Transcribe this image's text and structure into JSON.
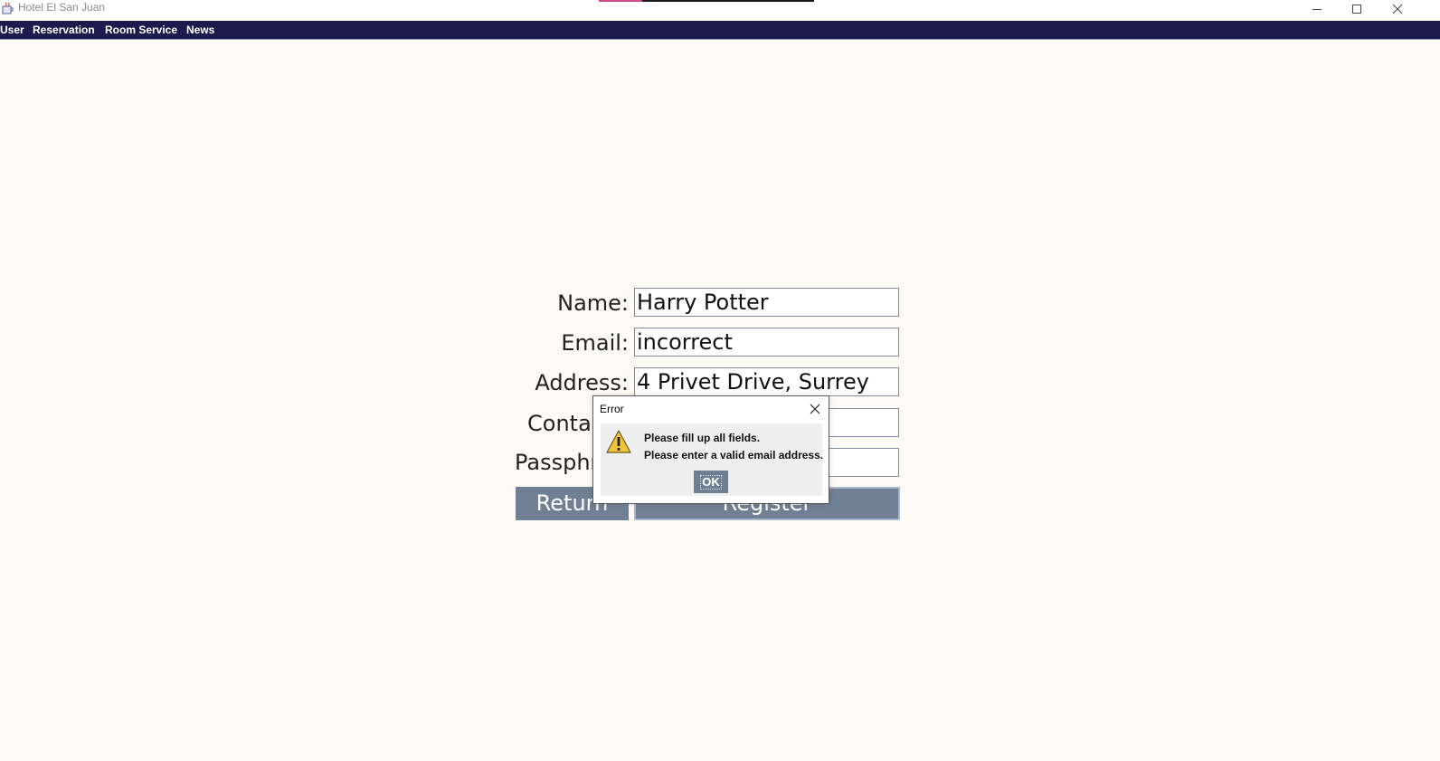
{
  "window": {
    "title": "Hotel El San Juan",
    "controls": [
      "minimize-icon",
      "maximize-icon",
      "close-icon"
    ]
  },
  "menu": {
    "items": [
      {
        "label": "User"
      },
      {
        "label": "Reservation"
      },
      {
        "label": "Room Service"
      },
      {
        "label": "News"
      }
    ]
  },
  "form": {
    "name_label": "Name:",
    "name_value": "Harry Potter",
    "email_label": "Email:",
    "email_value": "incorrect",
    "address_label": "Address:",
    "address_value": "4 Privet Drive, Surrey",
    "contact_label": "Contac",
    "contact_value": "",
    "passphrase_label": "Passphra",
    "passphrase_value": "",
    "return_label": "Return",
    "register_label": "Register"
  },
  "dialog": {
    "title": "Error",
    "icon": "warning-icon",
    "messages": [
      "Please fill up all fields.",
      "Please enter a valid email address."
    ],
    "ok_label": "OK"
  },
  "colors": {
    "menubar": "#1c1b4e",
    "background": "#fffaf5",
    "button": "#708094",
    "field_border": "#7f8ea3"
  }
}
